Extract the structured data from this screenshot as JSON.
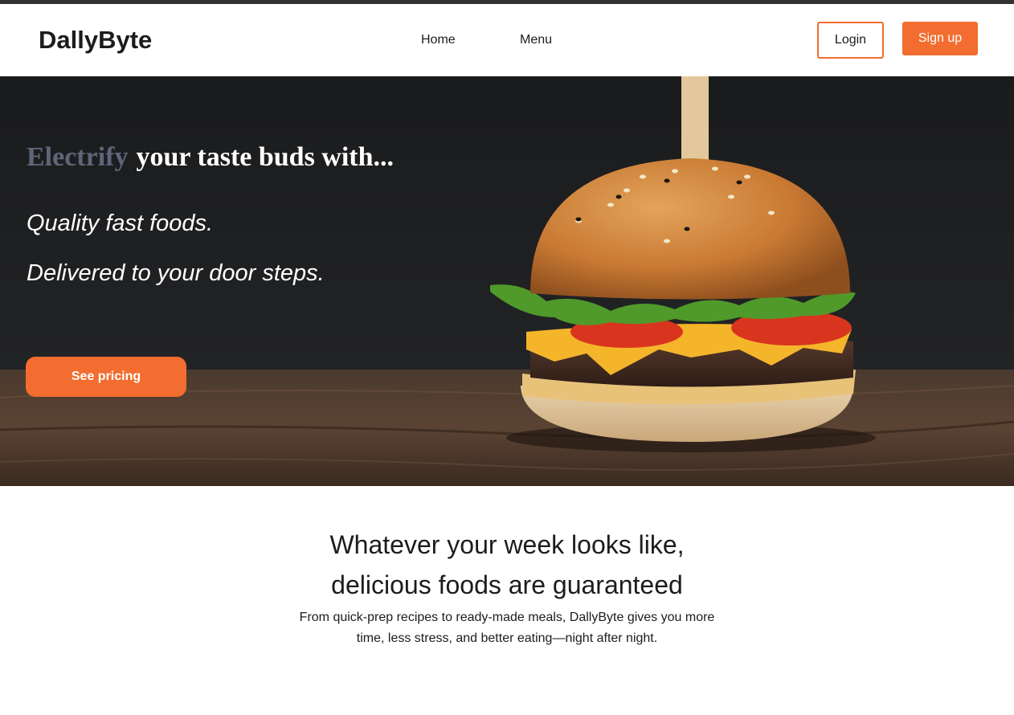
{
  "brand": {
    "name": "DallyByte",
    "accent_color": "#f26d2f"
  },
  "nav": {
    "links": [
      {
        "label": "Home"
      },
      {
        "label": "Menu"
      }
    ],
    "login_label": "Login",
    "signup_label": "Sign up"
  },
  "hero": {
    "headline_accent": "Electrify",
    "headline_rest": "your taste buds with...",
    "line1": "Quality fast foods.",
    "line2": "Delivered to your door steps.",
    "cta_label": "See pricing",
    "image": "burger-photo"
  },
  "intro": {
    "heading_line1": "Whatever your week looks like,",
    "heading_line2": "delicious foods are guaranteed",
    "body": "From quick-prep recipes to ready-made meals, DallyByte gives you more time, less stress, and better eating—night after night."
  }
}
